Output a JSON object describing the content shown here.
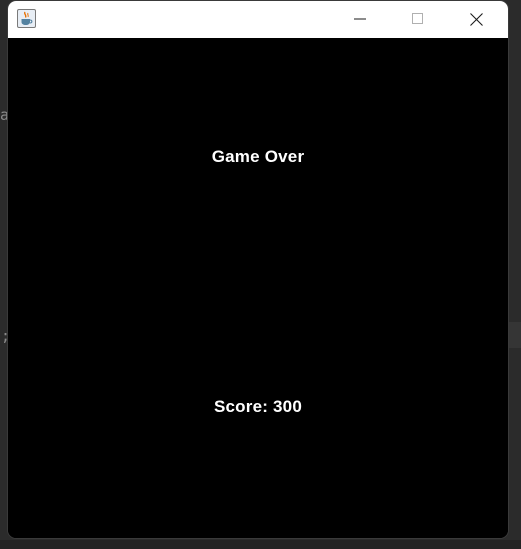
{
  "background": {
    "glyph_top": "a",
    "glyph_bottom": ";"
  },
  "window": {
    "title": "",
    "icon": "java-coffee-cup-icon",
    "controls": [
      "minimize-icon",
      "maximize-icon",
      "close-icon"
    ]
  },
  "game": {
    "message": "Game Over",
    "score_label": "Score: ",
    "score_value": "300",
    "text_color": "#ffffff",
    "canvas_color": "#000000"
  }
}
